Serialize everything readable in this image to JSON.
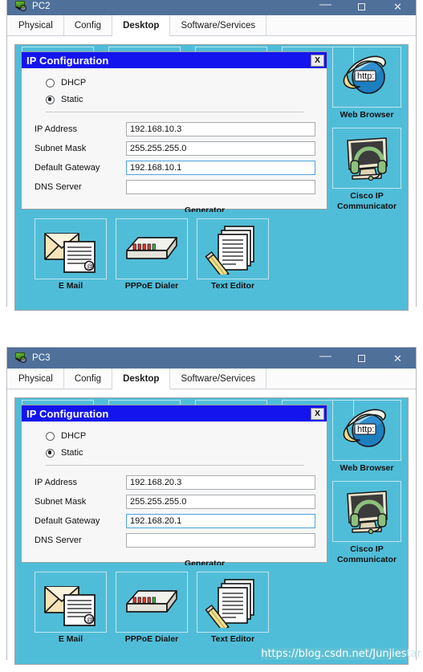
{
  "windows": [
    {
      "title": "PC2",
      "icon": "pc-device-icon",
      "controls": {
        "minimize": "—",
        "maximize": "maximize-icon",
        "close": "✕"
      },
      "tabs": [
        {
          "label": "Physical",
          "active": false
        },
        {
          "label": "Config",
          "active": false
        },
        {
          "label": "Desktop",
          "active": true
        },
        {
          "label": "Software/Services",
          "active": false
        }
      ],
      "dialog": {
        "title": "IP Configuration",
        "close_label": "X",
        "radios": [
          {
            "label": "DHCP",
            "selected": false
          },
          {
            "label": "Static",
            "selected": true
          }
        ],
        "fields": [
          {
            "label": "IP Address",
            "value": "192.168.10.3",
            "focused": false
          },
          {
            "label": "Subnet Mask",
            "value": "255.255.255.0",
            "focused": false
          },
          {
            "label": "Default Gateway",
            "value": "192.168.10.1",
            "focused": true
          },
          {
            "label": "DNS Server",
            "value": "",
            "focused": false
          }
        ]
      },
      "desktop_icons": [
        {
          "label": "E Mail",
          "icon": "email-icon"
        },
        {
          "label": "PPPoE Dialer",
          "icon": "pppoe-dialer-icon"
        },
        {
          "label": "Text Editor",
          "icon": "text-editor-icon"
        }
      ],
      "side_icons": [
        {
          "label": "Web Browser",
          "icon": "web-browser-icon"
        },
        {
          "label": "Cisco IP\nCommunicator",
          "line1": "Cisco IP",
          "line2": "Communicator",
          "icon": "ip-communicator-icon"
        }
      ],
      "obscured_label": "Generator"
    },
    {
      "title": "PC3",
      "icon": "pc-device-icon",
      "controls": {
        "minimize": "—",
        "maximize": "maximize-icon",
        "close": "✕"
      },
      "tabs": [
        {
          "label": "Physical",
          "active": false
        },
        {
          "label": "Config",
          "active": false
        },
        {
          "label": "Desktop",
          "active": true
        },
        {
          "label": "Software/Services",
          "active": false
        }
      ],
      "dialog": {
        "title": "IP Configuration",
        "close_label": "X",
        "radios": [
          {
            "label": "DHCP",
            "selected": false
          },
          {
            "label": "Static",
            "selected": true
          }
        ],
        "fields": [
          {
            "label": "IP Address",
            "value": "192.168.20.3",
            "focused": false
          },
          {
            "label": "Subnet Mask",
            "value": "255.255.255.0",
            "focused": false
          },
          {
            "label": "Default Gateway",
            "value": "192.168.20.1",
            "focused": true
          },
          {
            "label": "DNS Server",
            "value": "",
            "focused": false
          }
        ]
      },
      "desktop_icons": [
        {
          "label": "E Mail",
          "icon": "email-icon"
        },
        {
          "label": "PPPoE Dialer",
          "icon": "pppoe-dialer-icon"
        },
        {
          "label": "Text Editor",
          "icon": "text-editor-icon"
        }
      ],
      "side_icons": [
        {
          "label": "Web Browser",
          "icon": "web-browser-icon"
        },
        {
          "label": "Cisco IP\nCommunicator",
          "line1": "Cisco IP",
          "line2": "Communicator",
          "icon": "ip-communicator-icon"
        }
      ],
      "obscured_label": "Generator"
    }
  ],
  "watermark": {
    "text": "https://blog.csdn.net/Junjiestar",
    "highlighted": "https://blog.csdn.net/Junjies",
    "tail": "tar"
  },
  "colors": {
    "titlebar": "#4f7099",
    "desktop_teal": "#50bdd8",
    "dialog_title": "#1414ee",
    "focus_border": "#4ba3de",
    "window_border": "#b8bcc0"
  },
  "browser_icon_text": "http:"
}
